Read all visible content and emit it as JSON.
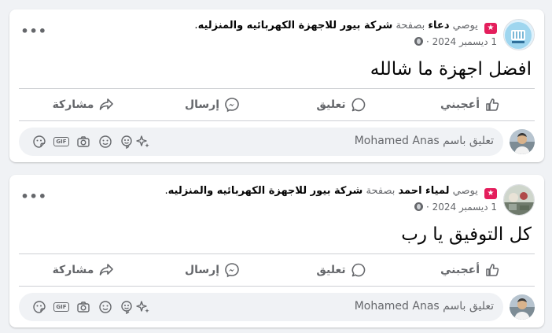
{
  "posts": [
    {
      "author": "دعاء",
      "via": "يوصي",
      "on_page_prefix": "بصفحة",
      "page_name": "شركة بيور للاجهزة الكهربائيه والمنزليه",
      "page_name_suffix": ".",
      "date": "1 ديسمبر 2024",
      "date_sep": "·",
      "body": "افضل اجهزة ما شالله",
      "more_label": "•••",
      "actions": {
        "like": "أعجبني",
        "comment": "تعليق",
        "send": "إرسال",
        "share": "مشاركة"
      },
      "comment_placeholder": "تعليق باسم Mohamed Anas",
      "gif_label": "GIF"
    },
    {
      "author": "لمياء احمد",
      "via": "يوصي",
      "on_page_prefix": "بصفحة",
      "page_name": "شركة بيور للاجهزة الكهربائيه والمنزليه",
      "page_name_suffix": ".",
      "date": "1 ديسمبر 2024",
      "date_sep": "·",
      "body": "كل التوفيق يا رب",
      "more_label": "•••",
      "actions": {
        "like": "أعجبني",
        "comment": "تعليق",
        "send": "إرسال",
        "share": "مشاركة"
      },
      "comment_placeholder": "تعليق باسم Mohamed Anas",
      "gif_label": "GIF"
    }
  ],
  "colors": {
    "badge": "#e41e5c",
    "muted": "#65676b",
    "bg": "#f0f2f5",
    "divider": "#ced0d4"
  },
  "icons": [
    "recommend-badge-icon",
    "globe-icon",
    "more-icon",
    "like-icon",
    "comment-icon",
    "messenger-icon",
    "share-icon",
    "sticker-icon",
    "gif-icon",
    "camera-icon",
    "emoji-icon",
    "avatar-sticker-icon",
    "sparkle-icon"
  ]
}
